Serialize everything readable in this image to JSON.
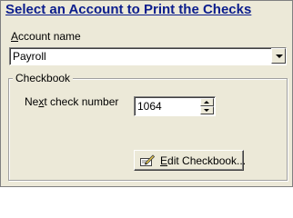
{
  "header": {
    "title": "Select an Account to Print the Checks"
  },
  "account": {
    "label_prefix": "A",
    "label_rest": "ccount name",
    "selected": "Payroll"
  },
  "checkbook": {
    "legend": "Checkbook",
    "next_check_label_pre": "Ne",
    "next_check_label_u": "x",
    "next_check_label_post": "t check number",
    "next_check_number": "1064",
    "edit_button_u": "E",
    "edit_button_rest": "dit Checkbook..."
  },
  "icons": {
    "combo_arrow": "chevron-down-icon",
    "spin_up": "arrow-up-icon",
    "spin_down": "arrow-down-icon",
    "edit": "edit-pencil-icon"
  }
}
